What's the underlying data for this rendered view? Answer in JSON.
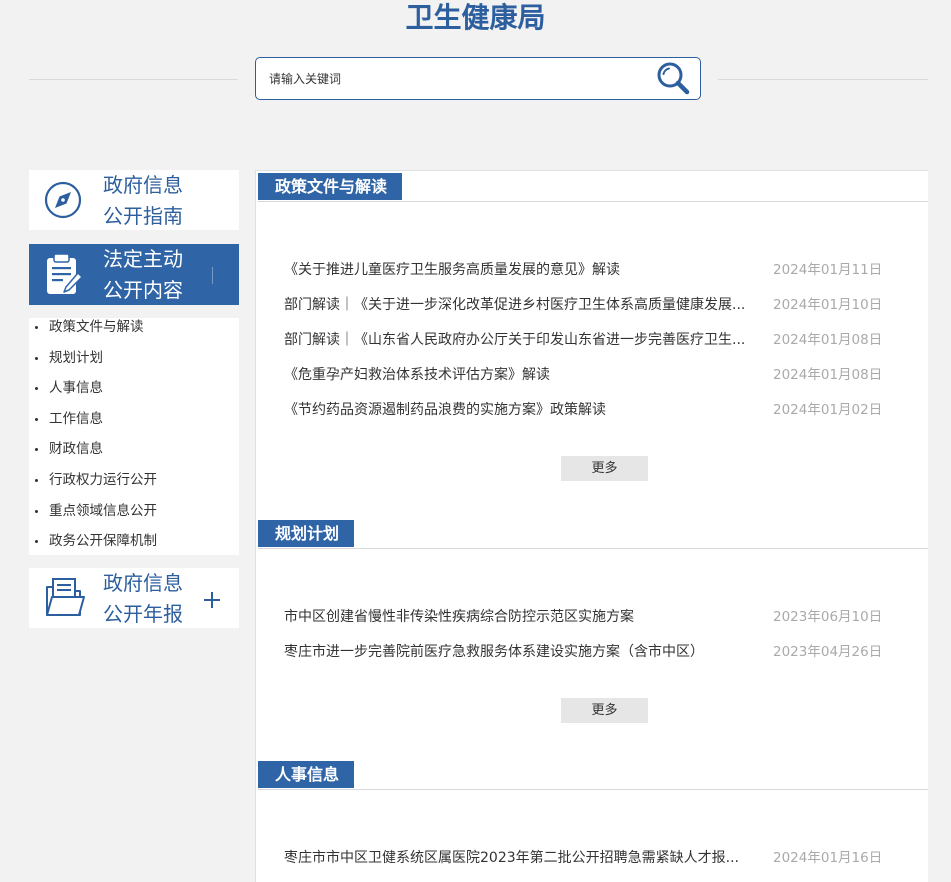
{
  "header": {
    "title": "卫生健康局"
  },
  "search": {
    "placeholder": "请输入关键词",
    "icon": "search-icon"
  },
  "sidebar": {
    "guide": {
      "line1": "政府信息",
      "line2": "公开指南",
      "icon": "compass-icon"
    },
    "active": {
      "line1": "法定主动",
      "line2": "公开内容",
      "icon": "clipboard-icon"
    },
    "subitems": [
      "政策文件与解读",
      "规划计划",
      "人事信息",
      "工作信息",
      "财政信息",
      "行政权力运行公开",
      "重点领域信息公开",
      "政务公开保障机制"
    ],
    "annual": {
      "line1": "政府信息",
      "line2": "公开年报",
      "icon": "folder-icon"
    }
  },
  "sections": [
    {
      "title": "政策文件与解读",
      "items": [
        {
          "title": "《关于推进儿童医疗卫生服务高质量发展的意见》解读",
          "date": "2024年01月11日"
        },
        {
          "title": "部门解读｜《关于进一步深化改革促进乡村医疗卫生体系高质量健康发展...",
          "date": "2024年01月10日"
        },
        {
          "title": "部门解读｜《山东省人民政府办公厅关于印发山东省进一步完善医疗卫生...",
          "date": "2024年01月08日"
        },
        {
          "title": "《危重孕产妇救治体系技术评估方案》解读",
          "date": "2024年01月08日"
        },
        {
          "title": "《节约药品资源遏制药品浪费的实施方案》政策解读",
          "date": "2024年01月02日"
        }
      ],
      "more": "更多"
    },
    {
      "title": "规划计划",
      "items": [
        {
          "title": "市中区创建省慢性非传染性疾病综合防控示范区实施方案",
          "date": "2023年06月10日"
        },
        {
          "title": "枣庄市进一步完善院前医疗急救服务体系建设实施方案（含市中区）",
          "date": "2023年04月26日"
        }
      ],
      "more": "更多"
    },
    {
      "title": "人事信息",
      "items": [
        {
          "title": "枣庄市市中区卫健系统区属医院2023年第二批公开招聘急需紧缺人才报...",
          "date": "2024年01月16日"
        }
      ]
    }
  ],
  "colors": {
    "primary": "#2f65a7",
    "accent": "#2d5f9f",
    "text": "#333333",
    "date": "#aaaaaa",
    "button_bg": "#e6e6e6",
    "page_bg": "#f2f2f2",
    "rule": "#d9d9d9"
  }
}
